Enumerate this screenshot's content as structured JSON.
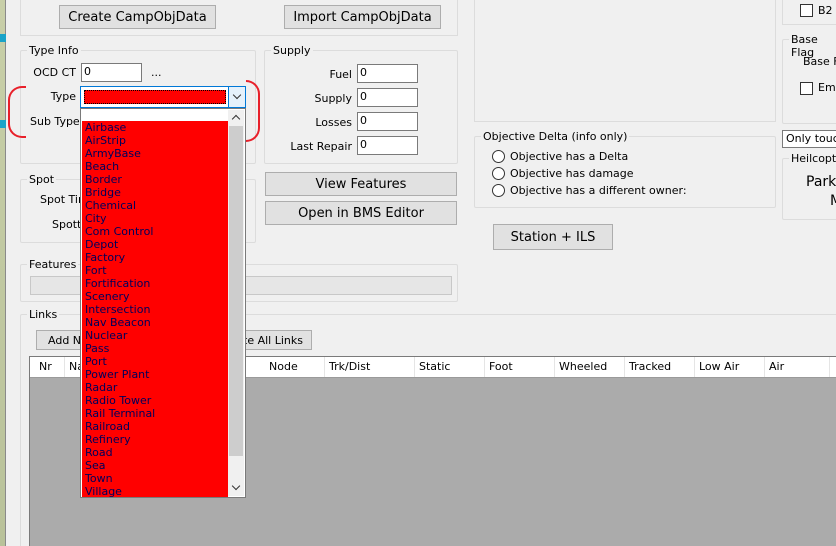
{
  "top_buttons": {
    "create": "Create CampObjData",
    "import": "Import CampObjData"
  },
  "type_info": {
    "caption": "Type Info",
    "ocd_ct_label": "OCD CT",
    "ocd_ct_value": "0",
    "ellipsis": "...",
    "type_label": "Type",
    "type_value": "",
    "sub_type_label": "Sub Type"
  },
  "supply": {
    "caption": "Supply",
    "fuel_label": "Fuel",
    "fuel_value": "0",
    "supply_label": "Supply",
    "supply_value": "0",
    "losses_label": "Losses",
    "losses_value": "0",
    "last_repair_label": "Last Repair",
    "last_repair_value": "0"
  },
  "spot": {
    "caption": "Spot",
    "spot_time_label": "Spot Tim",
    "spotted_label": "Spotte"
  },
  "actions": {
    "view_features": "View Features",
    "open_bms": "Open in BMS Editor",
    "station_ils": "Station + ILS"
  },
  "objective_delta": {
    "caption": "Objective Delta (info only)",
    "options": [
      "Objective has a Delta",
      "Objective has damage",
      "Objective has a different owner:"
    ]
  },
  "right_panel": {
    "b2_label": "B2",
    "base_flags_caption": "Base Flag",
    "base_f_label": "Base F",
    "emi_label": "Emi",
    "only_touch": "Only touch",
    "heli_caption": "Heilcopte",
    "park_text": "Park",
    "m_text": "M"
  },
  "features": {
    "caption": "Features"
  },
  "links": {
    "caption": "Links",
    "add_button": "Add Ne",
    "delete_all_button": "ete All Links",
    "columns": [
      "Nr",
      "Na",
      "Node",
      "Trk/Dist",
      "Static",
      "Foot",
      "Wheeled",
      "Tracked",
      "Low Air",
      "Air"
    ]
  },
  "type_dropdown": {
    "items": [
      "Airbase",
      "AirStrip",
      "ArmyBase",
      "Beach",
      "Border",
      "Bridge",
      "Chemical",
      "City",
      "Com Control",
      "Depot",
      "Factory",
      "Fort",
      "Fortification",
      "Scenery",
      "Intersection",
      "Nav Beacon",
      "Nuclear",
      "Pass",
      "Port",
      "Power Plant",
      "Radar",
      "Radio Tower",
      "Rail Terminal",
      "Railroad",
      "Refinery",
      "Road",
      "Sea",
      "Town",
      "Village"
    ]
  },
  "colors": {
    "highlight_red": "#ff0000",
    "annotation_red": "#e8202a",
    "grid_gray": "#ababab"
  }
}
